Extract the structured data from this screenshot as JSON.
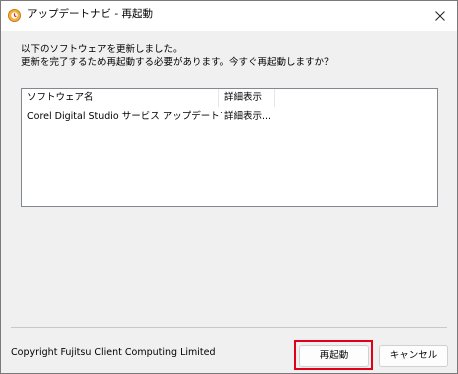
{
  "window": {
    "title": "アップデートナビ - 再起動",
    "close_glyph": "✕"
  },
  "message": {
    "line1": "以下のソフトウェアを更新しました。",
    "line2": "更新を完了するため再起動する必要があります。今すぐ再起動しますか？"
  },
  "list": {
    "columns": [
      "ソフトウェア名",
      "詳細表示"
    ],
    "rows": [
      [
        "Corel Digital Studio サービス アップデートプログラム",
        "詳細表示..."
      ]
    ]
  },
  "footer": {
    "copyright": "Copyright Fujitsu Client Computing Limited",
    "restart_label": "再起動",
    "cancel_label": "キャンセル"
  },
  "colors": {
    "highlight": "#e0001a",
    "app_icon": "#f0a020"
  }
}
